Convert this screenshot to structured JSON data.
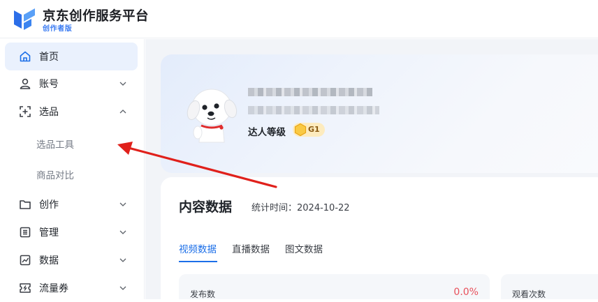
{
  "brand": {
    "title": "京东创作服务平台",
    "subtitle": "创作者版",
    "accent": "#3a7bf2"
  },
  "sidebar": {
    "items": [
      {
        "label": "首页",
        "icon": "home-icon",
        "active": true
      },
      {
        "label": "账号",
        "icon": "user-icon",
        "expandable": true,
        "expanded": false
      },
      {
        "label": "选品",
        "icon": "select-icon",
        "expandable": true,
        "expanded": true,
        "children": [
          {
            "label": "选品工具"
          },
          {
            "label": "商品对比"
          }
        ]
      },
      {
        "label": "创作",
        "icon": "folder-icon",
        "expandable": true,
        "expanded": false
      },
      {
        "label": "管理",
        "icon": "list-icon",
        "expandable": true,
        "expanded": false
      },
      {
        "label": "数据",
        "icon": "chart-icon",
        "expandable": true,
        "expanded": false
      },
      {
        "label": "流量券",
        "icon": "ticket-icon",
        "expandable": true,
        "expanded": false
      }
    ]
  },
  "profile": {
    "level_label": "达人等级",
    "level_badge": "G1",
    "badge_color": "#fdebbe"
  },
  "content": {
    "title": "内容数据",
    "stat_time": "统计时间：2024-10-22",
    "tabs": [
      {
        "label": "视频数据",
        "active": true
      },
      {
        "label": "直播数据",
        "active": false
      },
      {
        "label": "图文数据",
        "active": false
      }
    ],
    "metrics": [
      {
        "label": "发布数",
        "change": "0.0%"
      },
      {
        "label": "观看次数",
        "change": ""
      }
    ]
  },
  "colors": {
    "active_tab": "#1c6fe8",
    "negative_change": "#e8505b",
    "annotation_arrow": "#e0201b"
  }
}
